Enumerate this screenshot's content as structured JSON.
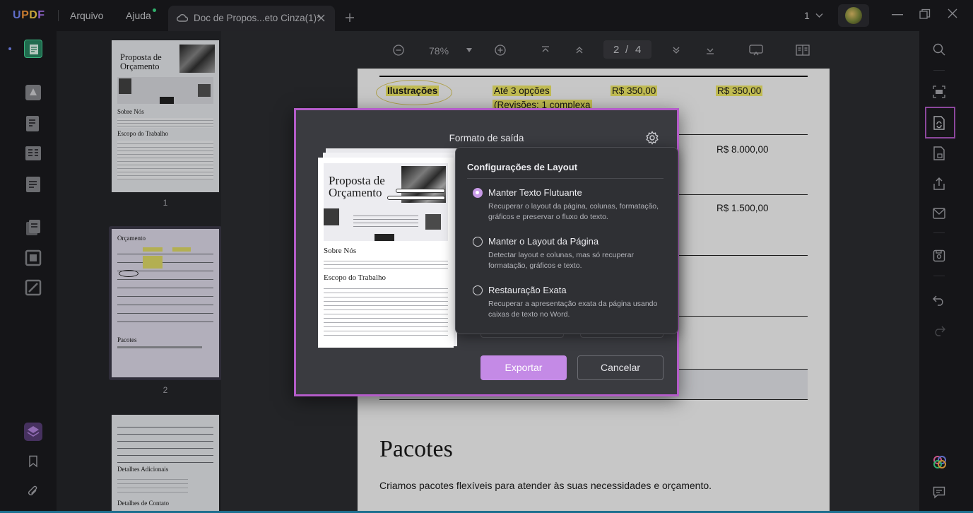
{
  "app": {
    "logo": "UPDF",
    "menu": [
      "Arquivo",
      "Ajuda"
    ],
    "tab_title": "Doc de Propos...eto Cinza(1)*",
    "page_count_indicator": "1"
  },
  "toolbar": {
    "zoom": "78%",
    "page_current": "2",
    "page_sep": "/",
    "page_total": "4"
  },
  "thumbnails": {
    "labels": [
      "1",
      "2"
    ],
    "t1": {
      "title_line1": "Proposta de",
      "title_line2": "Orçamento",
      "s1": "Sobre Nós",
      "s2": "Escopo do Trabalho"
    },
    "t2": {
      "title": "Orçamento",
      "s1": "Pacotes"
    },
    "t3": {
      "s1": "Detalhes Adicionais",
      "s2": "Detalhes de Contato"
    }
  },
  "document": {
    "row_label": "Ilustrações",
    "row_desc_1": "Até 3 opções",
    "row_desc_2": "(Revisões: 1 complexa",
    "row_price_a": "R$ 350,00",
    "row_price_b": "R$ 350,00",
    "total_1": "R$ 8.000,00",
    "total_2": "R$ 1.500,00",
    "section_title": "Pacotes",
    "section_body": "Criamos pacotes flexíveis para atender às suas necessidades e orçamento."
  },
  "dialog": {
    "title": "Formato de saída",
    "preview": {
      "title_line1": "Proposta de",
      "title_line2": "Orçamento",
      "s1": "Sobre Nós",
      "s2": "Escopo do Trabalho"
    },
    "layout_popup": {
      "title": "Configurações de Layout",
      "options": [
        {
          "label": "Manter Texto Flutuante",
          "description": "Recuperar o layout da página, colunas, formatação, gráficos e preservar o fluxo do texto.",
          "selected": true
        },
        {
          "label": "Manter o Layout da Página",
          "description": "Detectar layout e colunas, mas só recuperar formatação, gráficos e texto.",
          "selected": false
        },
        {
          "label": "Restauração Exata",
          "description": "Recuperar a apresentação exata da página usando caixas de texto no Word.",
          "selected": false
        }
      ]
    },
    "export_label": "Exportar",
    "cancel_label": "Cancelar"
  },
  "colors": {
    "accent": "#c48ae6",
    "highlight_border": "#b45cc9",
    "doc_highlight": "#f7f06a"
  }
}
